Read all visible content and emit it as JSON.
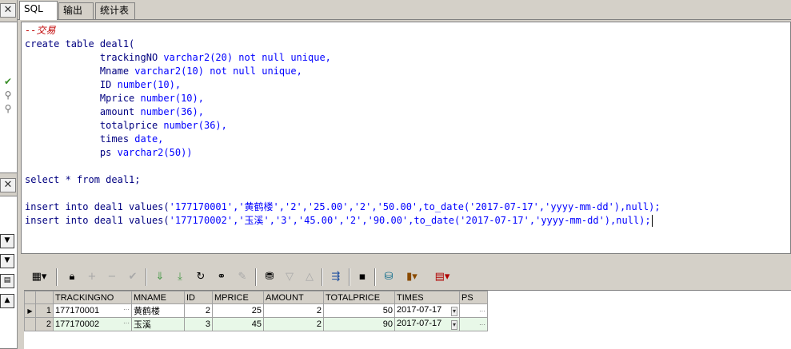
{
  "tabs": [
    {
      "label": "SQL"
    },
    {
      "label": "输出"
    },
    {
      "label": "统计表"
    }
  ],
  "editor": {
    "lines": [
      [
        {
          "t": "--交易",
          "c": "comment"
        }
      ],
      [
        {
          "t": "create table deal1(",
          "c": "kw"
        }
      ],
      [
        {
          "t": "             trackingNO ",
          "c": "kw"
        },
        {
          "t": "varchar2(20) not null unique,",
          "c": "str"
        }
      ],
      [
        {
          "t": "             Mname ",
          "c": "kw"
        },
        {
          "t": "varchar2(10) not null unique,",
          "c": "str"
        }
      ],
      [
        {
          "t": "             ID ",
          "c": "kw"
        },
        {
          "t": "number(10),",
          "c": "str"
        }
      ],
      [
        {
          "t": "             Mprice ",
          "c": "kw"
        },
        {
          "t": "number(10),",
          "c": "str"
        }
      ],
      [
        {
          "t": "             amount ",
          "c": "kw"
        },
        {
          "t": "number(36),",
          "c": "str"
        }
      ],
      [
        {
          "t": "             totalprice ",
          "c": "kw"
        },
        {
          "t": "number(36),",
          "c": "str"
        }
      ],
      [
        {
          "t": "             times ",
          "c": "kw"
        },
        {
          "t": "date,",
          "c": "str"
        }
      ],
      [
        {
          "t": "             ps ",
          "c": "kw"
        },
        {
          "t": "varchar2(50))",
          "c": "str"
        }
      ],
      [
        {
          "t": "",
          "c": "kw"
        }
      ],
      [
        {
          "t": "select * from deal1;",
          "c": "kw"
        }
      ],
      [
        {
          "t": "",
          "c": "kw"
        }
      ],
      [
        {
          "t": "insert into deal1 values(",
          "c": "kw"
        },
        {
          "t": "'177170001','黄鹤楼','2','25.00','2','50.00',to_date('2017-07-17','yyyy-mm-dd'),null);",
          "c": "str"
        }
      ],
      [
        {
          "t": "insert into deal1 values(",
          "c": "kw"
        },
        {
          "t": "'177170002','玉溪','3','45.00','2','90.00',to_date('2017-07-17','yyyy-mm-dd'),null);",
          "c": "str"
        }
      ]
    ]
  },
  "grid": {
    "columns": [
      "TRACKINGNO",
      "MNAME",
      "ID",
      "MPRICE",
      "AMOUNT",
      "TOTALPRICE",
      "TIMES",
      "PS"
    ],
    "rows": [
      {
        "num": "1",
        "trackingno": "177170001",
        "mname": "黄鹤楼",
        "id": "2",
        "mprice": "25",
        "amount": "2",
        "totalprice": "50",
        "times": "2017-07-17",
        "ps": ""
      },
      {
        "num": "2",
        "trackingno": "177170002",
        "mname": "玉溪",
        "id": "3",
        "mprice": "45",
        "amount": "2",
        "totalprice": "90",
        "times": "2017-07-17",
        "ps": ""
      }
    ]
  },
  "toolbar_icons": [
    "grid-view-icon",
    "lock-icon",
    "add-record-icon",
    "delete-record-icon",
    "post-record-icon",
    "next-page-icon",
    "last-page-icon",
    "refresh-icon",
    "find-icon",
    "clear-icon",
    "query-by-example-icon",
    "filter-icon",
    "sort-icon",
    "export-icon",
    "save-icon",
    "connection-icon",
    "chart-icon",
    "table-icon"
  ]
}
